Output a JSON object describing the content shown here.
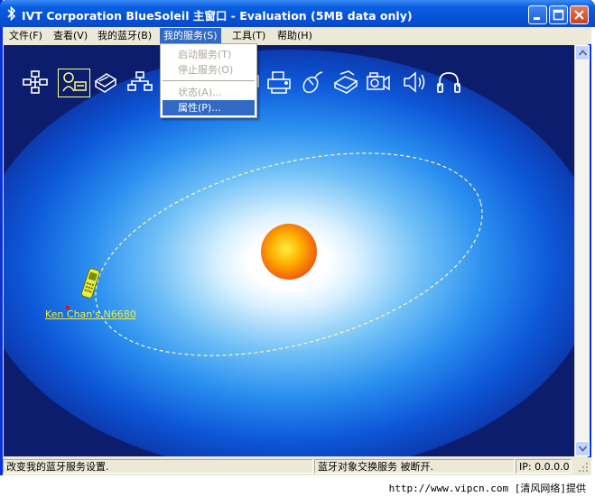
{
  "window": {
    "title": "IVT Corporation BlueSoleil 主窗口 - Evaluation (5MB data only)"
  },
  "menubar": {
    "items": [
      {
        "label": "文件(F)",
        "name": "menu-file"
      },
      {
        "label": "查看(V)",
        "name": "menu-view"
      },
      {
        "label": "我的蓝牙(B)",
        "name": "menu-my-bluetooth"
      },
      {
        "label": "我的服务(S)",
        "name": "menu-my-services"
      },
      {
        "label": "工具(T)",
        "name": "menu-tools"
      },
      {
        "label": "帮助(H)",
        "name": "menu-help"
      }
    ]
  },
  "dropdown": {
    "items": [
      {
        "label": "启动服务(T)",
        "enabled": false
      },
      {
        "label": "停止服务(O)",
        "enabled": false
      },
      {
        "label": "状态(A)...",
        "enabled": false
      },
      {
        "label": "属性(P)...",
        "enabled": true,
        "highlighted": true
      }
    ]
  },
  "service_icons": [
    "network-icon",
    "pan-icon",
    "fax-icon",
    "lan-icon",
    "serial-icon",
    "printer-icon",
    "mouse-icon",
    "file-transfer-icon",
    "camera-icon",
    "speaker-icon",
    "headset-icon"
  ],
  "device": {
    "label": "Ken Chan's N6680",
    "icon": "mobile-phone-icon"
  },
  "status": {
    "message": "改变我的蓝牙服务设置.",
    "connection": "蓝牙对象交换服务 被断开.",
    "ip": "IP: 0.0.0.0"
  },
  "watermark": "http://www.vipcn.com [清风网络]提供",
  "colors": {
    "titlebar": "#0a5fe0",
    "canvas_bg": "#0d1d6e",
    "glow": "#2a8ff0",
    "sun": "#f06010",
    "device_label": "#e8f040",
    "menu_highlight": "#316ac5"
  }
}
